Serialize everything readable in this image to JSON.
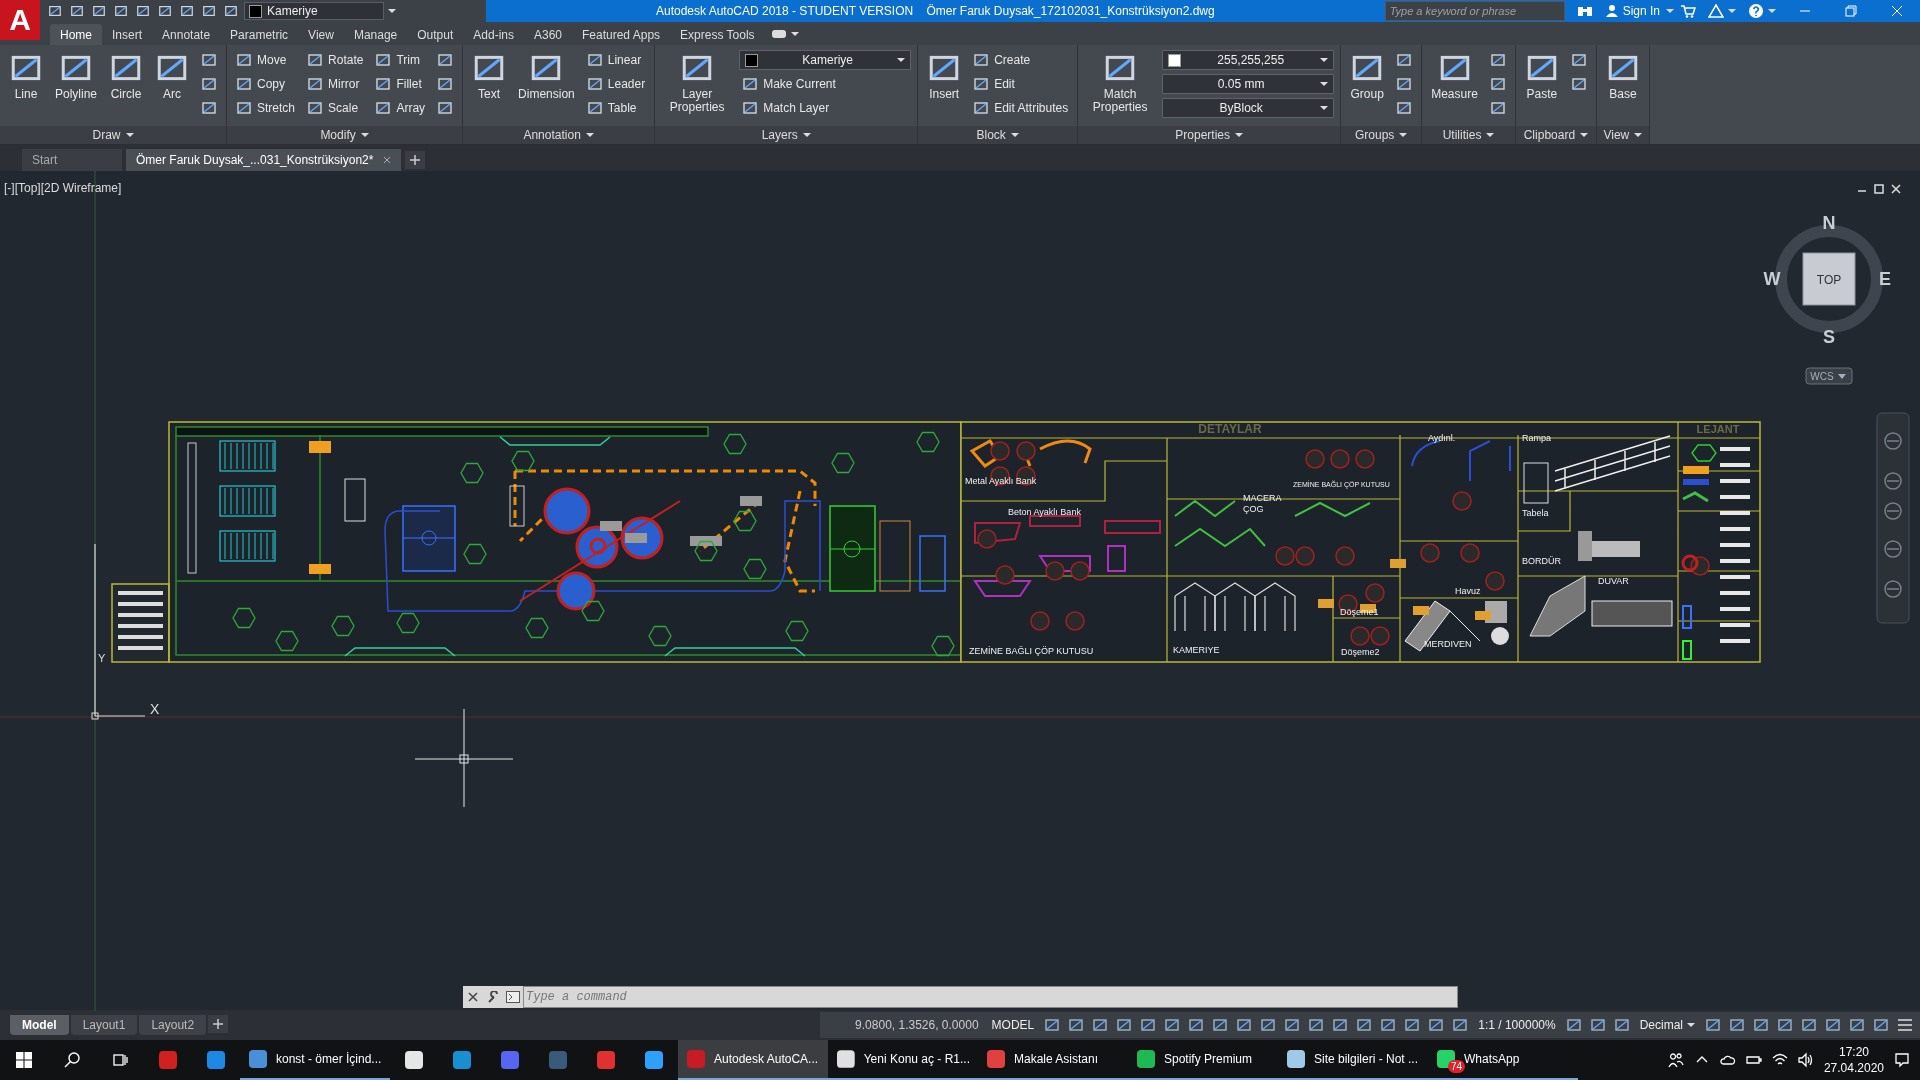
{
  "title_bar": {
    "logo": "A",
    "layer_combo": {
      "value": "Kameriye",
      "color": "#000000"
    },
    "title": "Autodesk AutoCAD 2018 - STUDENT VERSION    Ömer Faruk Duysak_172102031_Konstrüksiyon2.dwg",
    "search_placeholder": "Type a keyword or phrase",
    "sign_in": "Sign In"
  },
  "ribbon_tabs": [
    {
      "label": "Home",
      "selected": true
    },
    {
      "label": "Insert",
      "selected": false
    },
    {
      "label": "Annotate",
      "selected": false
    },
    {
      "label": "Parametric",
      "selected": false
    },
    {
      "label": "View",
      "selected": false
    },
    {
      "label": "Manage",
      "selected": false
    },
    {
      "label": "Output",
      "selected": false
    },
    {
      "label": "Add-ins",
      "selected": false
    },
    {
      "label": "A360",
      "selected": false
    },
    {
      "label": "Featured Apps",
      "selected": false
    },
    {
      "label": "Express Tools",
      "selected": false
    }
  ],
  "ribbon_panels": [
    {
      "title": "Draw",
      "columns": [
        {
          "kind": "large",
          "label": "Line"
        },
        {
          "kind": "large",
          "label": "Polyline"
        },
        {
          "kind": "large",
          "label": "Circle"
        },
        {
          "kind": "large",
          "label": "Arc"
        },
        {
          "kind": "stack",
          "items": [
            {
              "kind": "icon"
            },
            {
              "kind": "icon"
            },
            {
              "kind": "icon"
            }
          ]
        }
      ]
    },
    {
      "title": "Modify",
      "columns": [
        {
          "kind": "stack",
          "items": [
            {
              "kind": "tool",
              "label": "Move"
            },
            {
              "kind": "tool",
              "label": "Copy"
            },
            {
              "kind": "tool",
              "label": "Stretch"
            }
          ]
        },
        {
          "kind": "stack",
          "items": [
            {
              "kind": "tool",
              "label": "Rotate"
            },
            {
              "kind": "tool",
              "label": "Mirror"
            },
            {
              "kind": "tool",
              "label": "Scale"
            }
          ]
        },
        {
          "kind": "stack",
          "items": [
            {
              "kind": "tool",
              "label": "Trim"
            },
            {
              "kind": "tool",
              "label": "Fillet"
            },
            {
              "kind": "tool",
              "label": "Array"
            }
          ]
        },
        {
          "kind": "stack",
          "items": [
            {
              "kind": "icon"
            },
            {
              "kind": "icon"
            },
            {
              "kind": "icon"
            }
          ]
        }
      ]
    },
    {
      "title": "Annotation",
      "columns": [
        {
          "kind": "large",
          "label": "Text"
        },
        {
          "kind": "large",
          "label": "Dimension"
        },
        {
          "kind": "stack",
          "items": [
            {
              "kind": "tool",
              "label": "Linear"
            },
            {
              "kind": "tool",
              "label": "Leader"
            },
            {
              "kind": "tool",
              "label": "Table"
            }
          ]
        }
      ]
    },
    {
      "title": "Layers",
      "columns": [
        {
          "kind": "large",
          "label": "Layer Properties"
        },
        {
          "kind": "stack",
          "items": [
            {
              "kind": "color_combo",
              "value": "Kameriye",
              "color": "#000000"
            },
            {
              "kind": "tool",
              "label": "Make Current"
            },
            {
              "kind": "tool",
              "label": "Match Layer"
            }
          ]
        }
      ]
    },
    {
      "title": "Block",
      "columns": [
        {
          "kind": "large",
          "label": "Insert"
        },
        {
          "kind": "stack",
          "items": [
            {
              "kind": "tool",
              "label": "Create"
            },
            {
              "kind": "tool",
              "label": "Edit"
            },
            {
              "kind": "tool",
              "label": "Edit Attributes"
            }
          ]
        }
      ]
    },
    {
      "title": "Properties",
      "columns": [
        {
          "kind": "large",
          "label": "Match Properties"
        },
        {
          "kind": "stack",
          "items": [
            {
              "kind": "color_combo",
              "value": "255,255,255",
              "color": "#ffffff"
            },
            {
              "kind": "combo",
              "value": "0.05 mm"
            },
            {
              "kind": "combo",
              "value": "ByBlock"
            }
          ]
        }
      ]
    },
    {
      "title": "Groups",
      "columns": [
        {
          "kind": "large",
          "label": "Group"
        },
        {
          "kind": "stack",
          "items": [
            {
              "kind": "icon"
            },
            {
              "kind": "icon"
            },
            {
              "kind": "icon"
            }
          ]
        }
      ]
    },
    {
      "title": "Utilities",
      "columns": [
        {
          "kind": "large",
          "label": "Measure"
        },
        {
          "kind": "stack",
          "items": [
            {
              "kind": "icon"
            },
            {
              "kind": "icon"
            },
            {
              "kind": "icon"
            }
          ]
        }
      ]
    },
    {
      "title": "Clipboard",
      "columns": [
        {
          "kind": "large",
          "label": "Paste"
        },
        {
          "kind": "stack",
          "items": [
            {
              "kind": "icon"
            },
            {
              "kind": "icon"
            }
          ]
        }
      ]
    },
    {
      "title": "View",
      "columns": [
        {
          "kind": "large",
          "label": "Base"
        }
      ]
    }
  ],
  "file_tabs": [
    {
      "label": "Start",
      "selected": false
    },
    {
      "label": "Ömer Faruk Duysak_...031_Konstrüksiyon2*",
      "selected": true
    }
  ],
  "viewport": {
    "label": "[-][Top][2D Wireframe]",
    "compass": {
      "north": "N",
      "south": "S",
      "east": "E",
      "west": "W",
      "cube": "TOP",
      "ucs_button": "WCS"
    },
    "ucs": {
      "x_label": "X",
      "y_label": "Y"
    },
    "drawing_labels": [
      {
        "kind": "title",
        "text": "DETAYLAR"
      },
      {
        "kind": "title",
        "text": "LEJANT"
      },
      {
        "kind": "label",
        "text": "Metal Ayaklı Bank"
      },
      {
        "kind": "label",
        "text": "Beton Ayaklı Bank"
      },
      {
        "kind": "label",
        "text": "ZEMİNE BAĞLI ÇÖP KUTUSU"
      },
      {
        "kind": "label",
        "text": "ZEMİNE BAĞLI ÇÖP KUTUSU"
      },
      {
        "kind": "label",
        "text": "MACERA"
      },
      {
        "kind": "label",
        "text": "ÇOG"
      },
      {
        "kind": "label",
        "text": "KAMERIYE"
      },
      {
        "kind": "label",
        "text": "Döşeme1"
      },
      {
        "kind": "label",
        "text": "Döşeme2"
      },
      {
        "kind": "label",
        "text": "Aydınl."
      },
      {
        "kind": "label",
        "text": "Rampa"
      },
      {
        "kind": "label",
        "text": "Tabela"
      },
      {
        "kind": "label",
        "text": "BORDÜR"
      },
      {
        "kind": "label",
        "text": "Havuz"
      },
      {
        "kind": "label",
        "text": "DUVAR"
      },
      {
        "kind": "label",
        "text": "MERDIVEN"
      }
    ],
    "command_placeholder": "Type a command"
  },
  "layout_tabs": [
    {
      "label": "Model",
      "selected": true
    },
    {
      "label": "Layout1",
      "selected": false
    },
    {
      "label": "Layout2",
      "selected": false
    }
  ],
  "status_bar": {
    "coordinates": "9.0800, 1.3526, 0.0000",
    "space": "MODEL",
    "scale": "1:1 / 100000%",
    "units": "Decimal"
  },
  "taskbar": {
    "items": [
      {
        "kind": "app",
        "selected": false
      },
      {
        "kind": "app",
        "selected": false
      },
      {
        "kind": "window",
        "label": "konst - ömer İçind...",
        "selected": false
      },
      {
        "kind": "app",
        "selected": false
      },
      {
        "kind": "app",
        "selected": false
      },
      {
        "kind": "app",
        "selected": false
      },
      {
        "kind": "app",
        "selected": false
      },
      {
        "kind": "app",
        "selected": false
      },
      {
        "kind": "app",
        "selected": false
      },
      {
        "kind": "window",
        "label": "Autodesk AutoCA...",
        "selected": true
      },
      {
        "kind": "window",
        "label": "Yeni Konu aç - R1...",
        "selected": false
      },
      {
        "kind": "window",
        "label": "Makale Asistanı",
        "selected": false
      },
      {
        "kind": "window",
        "label": "Spotify Premium",
        "selected": false
      },
      {
        "kind": "window",
        "label": "Site bilgileri - Not ...",
        "selected": false
      },
      {
        "kind": "window",
        "label": "WhatsApp",
        "selected": false,
        "badge": "74"
      }
    ],
    "time": "17:20",
    "date": "27.04.2020"
  }
}
